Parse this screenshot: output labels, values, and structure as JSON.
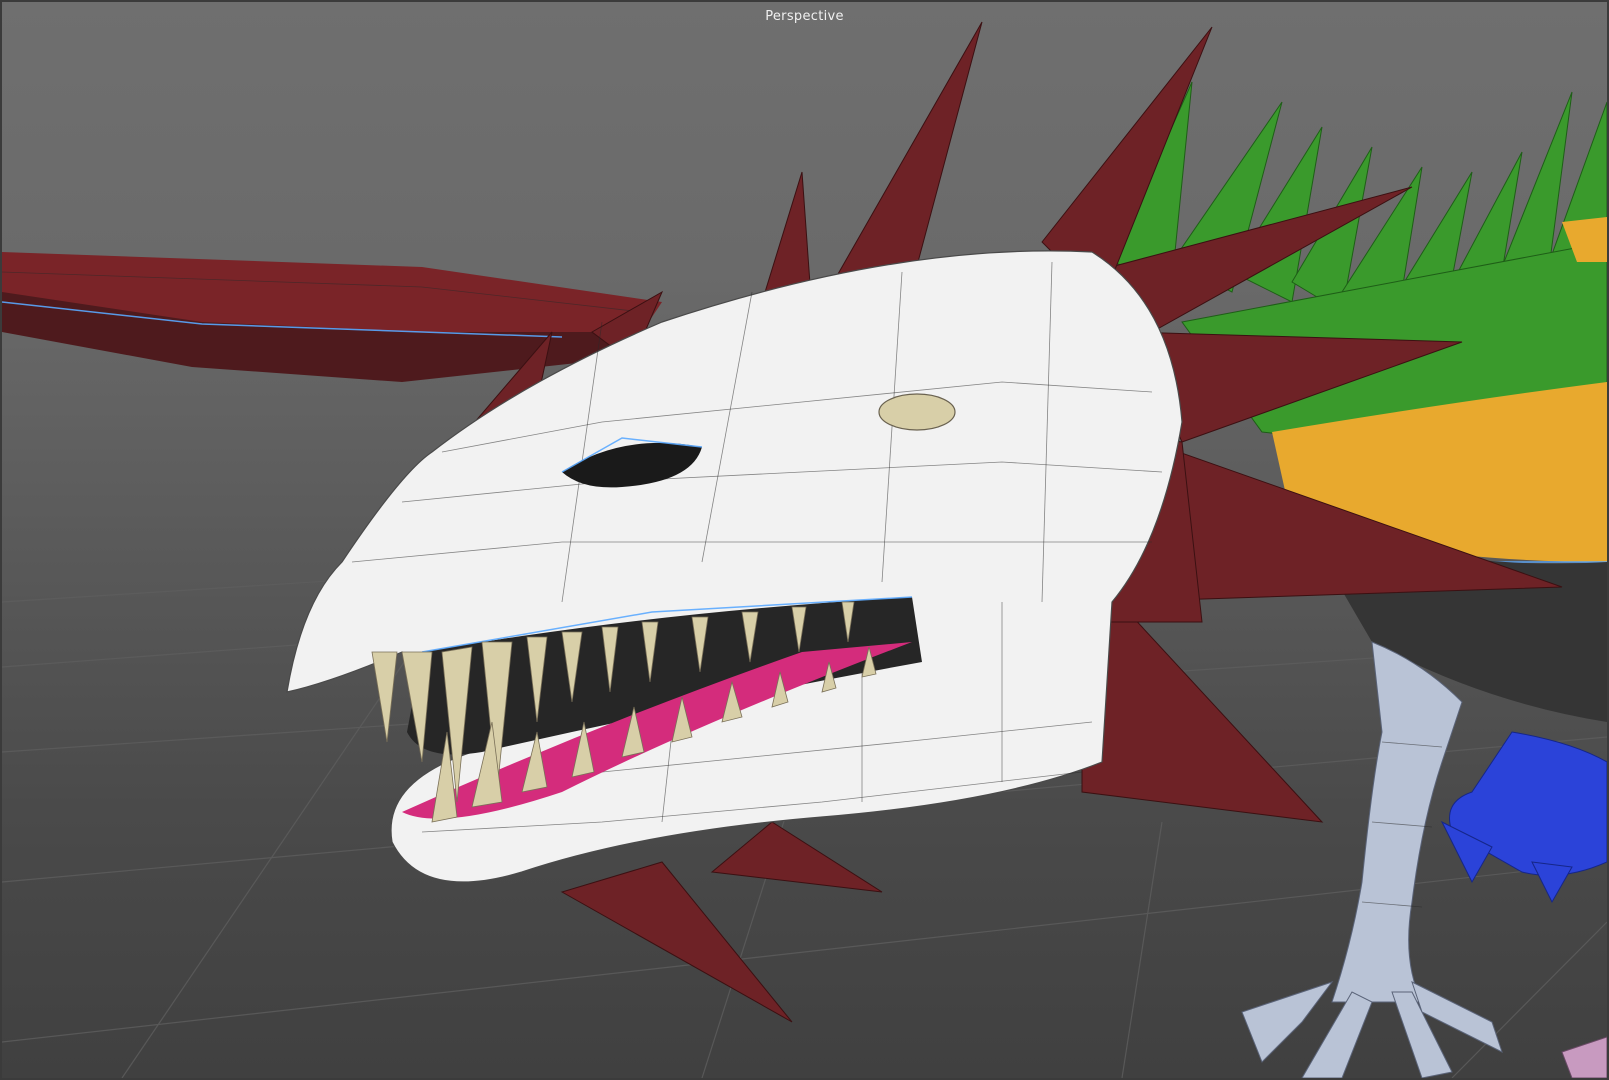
{
  "viewport": {
    "label": "Perspective",
    "camera": "perspective"
  },
  "scene": {
    "subject": "dragon-head-mesh",
    "colors": {
      "background_top": "#6f6f6f",
      "background_bottom": "#404040",
      "grid": "#5e5e5e",
      "skull": "#f2f2f2",
      "horns": "#6e2226",
      "spikes": "#3a9a2c",
      "belly": "#e8a92e",
      "gums": "#d42c7c",
      "teeth": "#d8cfa8",
      "leg": "#b9c3d6",
      "foot": "#2b43d9",
      "edge_highlight": "#5aa8ff"
    }
  }
}
